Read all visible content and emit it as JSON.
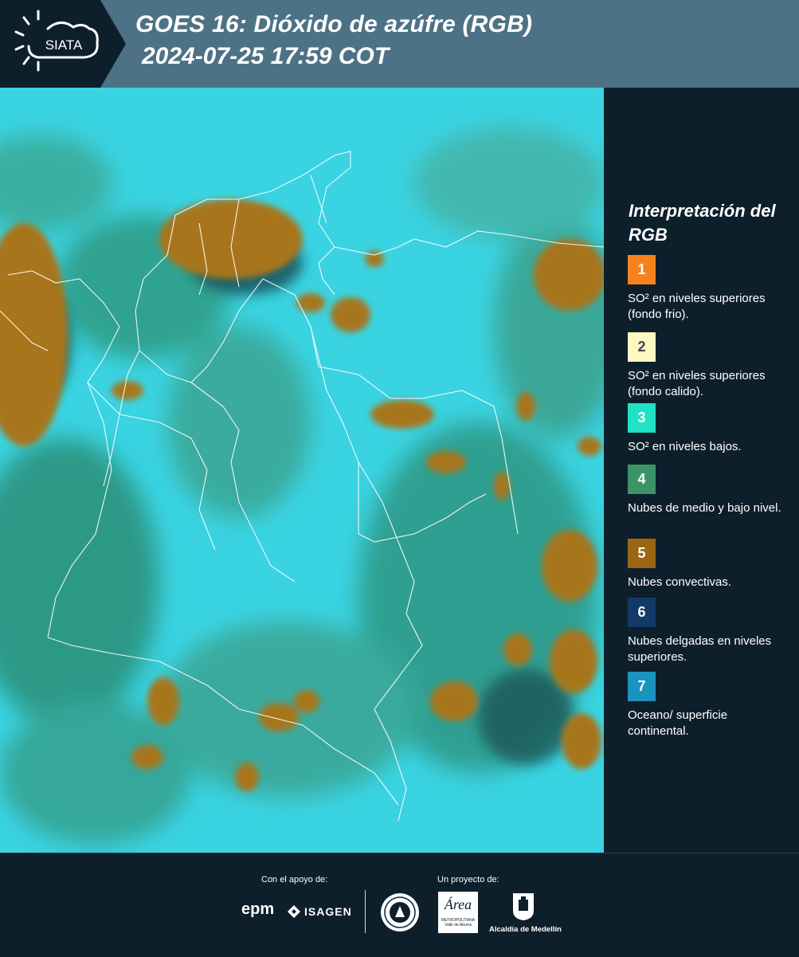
{
  "header": {
    "brand": "SIATA",
    "title_line1": "GOES 16: Dióxido de azúfre (RGB)",
    "title_line2": "2024-07-25 17:59 COT"
  },
  "legend": {
    "title": "Interpretación del RGB",
    "items": [
      {
        "num": "1",
        "color": "#f5821e",
        "text": "SO² en niveles superiores (fondo frio)."
      },
      {
        "num": "2",
        "color": "#fdf7c1",
        "text": "SO² en niveles superiores (fondo calido)."
      },
      {
        "num": "3",
        "color": "#20e2c4",
        "text": "SO² en niveles bajos."
      },
      {
        "num": "4",
        "color": "#3a9467",
        "text": "Nubes de medio y bajo nivel."
      },
      {
        "num": "5",
        "color": "#9b6614",
        "text": "Nubes convectivas."
      },
      {
        "num": "6",
        "color": "#123a68",
        "text": "Nubes delgadas en niveles superiores."
      },
      {
        "num": "7",
        "color": "#1b94bd",
        "text": "Oceano/ superficie continental."
      }
    ]
  },
  "footer": {
    "support_label": "Con el apoyo de:",
    "project_label": "Un proyecto de:",
    "epm": "epm",
    "isagen": "ISAGEN",
    "metro_area": "Área",
    "metro_sub": "METROPOLITANA",
    "metro_sub2": "Valle de Aburrá",
    "alcaldia": "Alcaldía de Medellín"
  }
}
